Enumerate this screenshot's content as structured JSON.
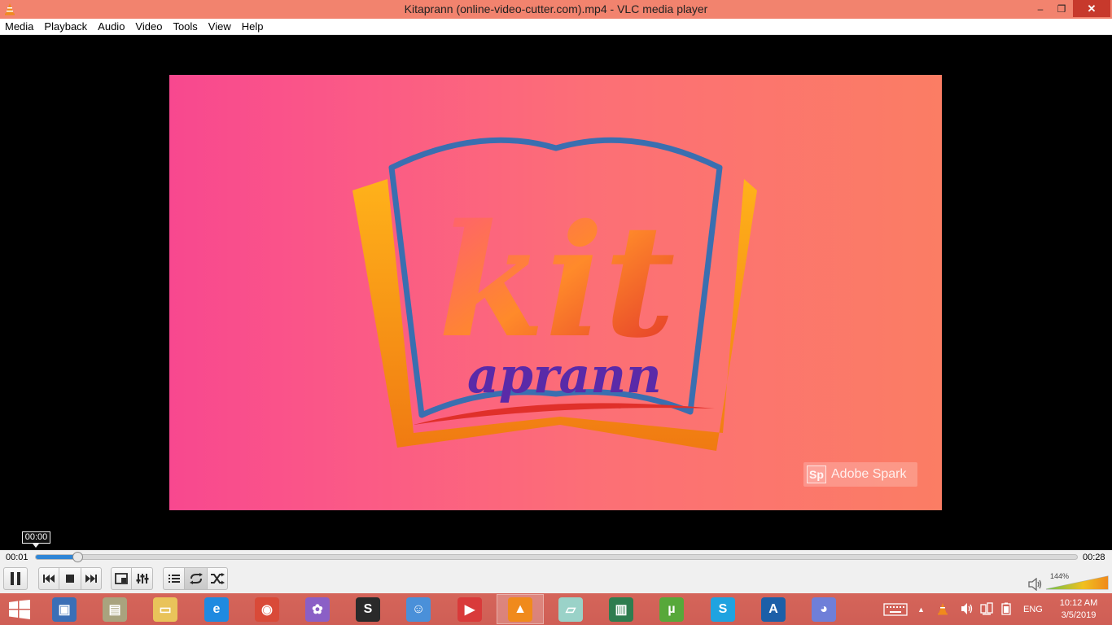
{
  "window": {
    "title": "Kitaprann (online-video-cutter.com).mp4 - VLC media player",
    "icon": "vlc-cone-icon",
    "buttons": {
      "minimize": "–",
      "maximize": "❐",
      "close": "✕"
    }
  },
  "menu": {
    "items": [
      "Media",
      "Playback",
      "Audio",
      "Video",
      "Tools",
      "View",
      "Help"
    ]
  },
  "video": {
    "logo_main_text": "kit",
    "logo_sub_text": "aprann",
    "watermark_logo": "Sp",
    "watermark_text": "Adobe Spark",
    "colors": {
      "gradient_start": "#f8488f",
      "gradient_end": "#fb7d64",
      "book_blue": "#3a6fb0",
      "sub_purple": "#5a2aa8"
    }
  },
  "playback": {
    "hover_time": "00:00",
    "elapsed": "00:01",
    "total": "00:28",
    "progress_fraction": 0.04
  },
  "controls": {
    "buttons": [
      "pause-icon",
      "previous-icon",
      "stop-icon",
      "next-icon",
      "fullscreen-icon",
      "extended-settings-icon",
      "playlist-icon",
      "loop-icon",
      "random-icon"
    ],
    "volume_percent_label": "144%",
    "volume_fraction": 1.0
  },
  "taskbar": {
    "apps": [
      {
        "name": "remote-desktop-icon",
        "color": "#3b6fb6",
        "glyph": "▣",
        "active": false
      },
      {
        "name": "paper-app-icon",
        "color": "#a9a37e",
        "glyph": "▤",
        "active": false
      },
      {
        "name": "file-explorer-icon",
        "color": "#e9c35a",
        "glyph": "▭",
        "active": false
      },
      {
        "name": "internet-explorer-icon",
        "color": "#1f8ae0",
        "glyph": "e",
        "active": false
      },
      {
        "name": "chrome-icon",
        "color": "#d94a38",
        "glyph": "◉",
        "active": false
      },
      {
        "name": "picasa-icon",
        "color": "#8b5fc6",
        "glyph": "✿",
        "active": false
      },
      {
        "name": "sublime-text-icon",
        "color": "#2a2a2a",
        "glyph": "S",
        "active": false
      },
      {
        "name": "user-app-icon",
        "color": "#4a90d9",
        "glyph": "☺",
        "active": false
      },
      {
        "name": "video-recorder-icon",
        "color": "#d93a3a",
        "glyph": "▶",
        "active": false
      },
      {
        "name": "vlc-icon",
        "color": "#f08a1c",
        "glyph": "▲",
        "active": true
      },
      {
        "name": "sticky-notes-icon",
        "color": "#9ad2c8",
        "glyph": "▱",
        "active": false
      },
      {
        "name": "books-app-icon",
        "color": "#2e7d4f",
        "glyph": "▥",
        "active": false
      },
      {
        "name": "utorrent-icon",
        "color": "#57a83a",
        "glyph": "µ",
        "active": false
      },
      {
        "name": "skype-icon",
        "color": "#1fa3e0",
        "glyph": "S",
        "active": false
      },
      {
        "name": "azure-icon",
        "color": "#1c5fa8",
        "glyph": "A",
        "active": false
      },
      {
        "name": "discord-icon",
        "color": "#6f7fd8",
        "glyph": "◕",
        "active": false
      }
    ],
    "tray": {
      "language": "ENG",
      "time": "10:12 AM",
      "date": "3/5/2019"
    }
  }
}
